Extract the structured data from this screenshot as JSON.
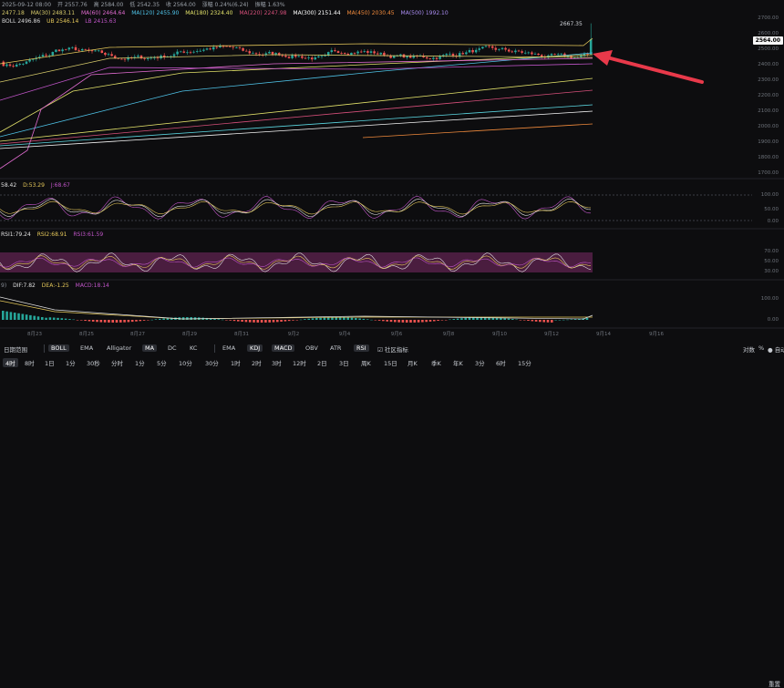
{
  "header": {
    "ohlc": [
      "2025-09-12 08:00",
      "开 2557.76",
      "高 2584.00",
      "低 2542.35",
      "收 2564.00",
      "涨幅 0.24%(6.24)",
      "振幅 1.63%"
    ],
    "ma_line": [
      "2477.18",
      "MA(30) 2483.11",
      "MA(60) 2464.64",
      "MA(120) 2455.90",
      "MA(180) 2324.40",
      "MA(220) 2247.98",
      "MA(300) 2151.44",
      "MA(450) 2030.45",
      "MA(500) 1992.10"
    ],
    "boll_line": [
      "BOLL 2496.86",
      "UB 2546.14",
      "LB 2415.63"
    ]
  },
  "colors": {
    "bg": "#0d0d0f",
    "up": "#26a69a",
    "down": "#ef5350",
    "arrow": "#e8394a",
    "rsi_band": "#4a1d3f"
  },
  "main_chart": {
    "last_price": "2564.00",
    "peak_label": "2667.35",
    "y_ticks": [
      "2700.00",
      "2600.00",
      "2500.00",
      "2400.00",
      "2300.00",
      "2200.00",
      "2100.00",
      "2000.00",
      "1900.00",
      "1800.00",
      "1700.00"
    ],
    "y_range": [
      1700,
      2700
    ],
    "candles": {
      "count": 180,
      "last_close": 2564,
      "last_high": 2667
    }
  },
  "kdj_panel": {
    "label": [
      "58.42",
      "D:53.29",
      "J:68.67"
    ],
    "y_ticks": [
      "100.00",
      "50.00",
      "0.00"
    ]
  },
  "rsi_panel": {
    "label": [
      "RSI1:79.24",
      "RSI2:68.91",
      "RSI3:61.59"
    ],
    "y_ticks": [
      "70.00",
      "50.00",
      "30.00"
    ]
  },
  "macd_panel": {
    "label": [
      "9)",
      "DIF:7.82",
      "DEA:-1.25",
      "MACD:18.14"
    ],
    "y_ticks": [
      "100.00",
      "0.00"
    ]
  },
  "x_axis": {
    "labels": [
      "8月23",
      "8月25",
      "8月27",
      "8月29",
      "8月31",
      "9月2",
      "9月4",
      "9月6",
      "9月8",
      "9月10",
      "9月12",
      "9月14",
      "9月16"
    ]
  },
  "toolbar": {
    "range_label": "日期范围",
    "indicators_left": [
      "BOLL",
      "EMA",
      "Alligator",
      "MA",
      "DC",
      "KC"
    ],
    "indicators_right": [
      "EMA",
      "KDJ",
      "MACD",
      "OBV",
      "ATR",
      "RSI"
    ],
    "community": "社区指标",
    "right_items": [
      "对数",
      "%",
      "自动"
    ],
    "right_top": "重置"
  },
  "intervals": [
    "4时",
    "8时",
    "1日",
    "1分",
    "30秒",
    "分时",
    "1分",
    "5分",
    "10分",
    "30分",
    "1时",
    "2时",
    "3时",
    "12时",
    "2日",
    "3日",
    "周K",
    "15日",
    "月K",
    "季K",
    "年K",
    "3分",
    "6时",
    "15分"
  ]
}
